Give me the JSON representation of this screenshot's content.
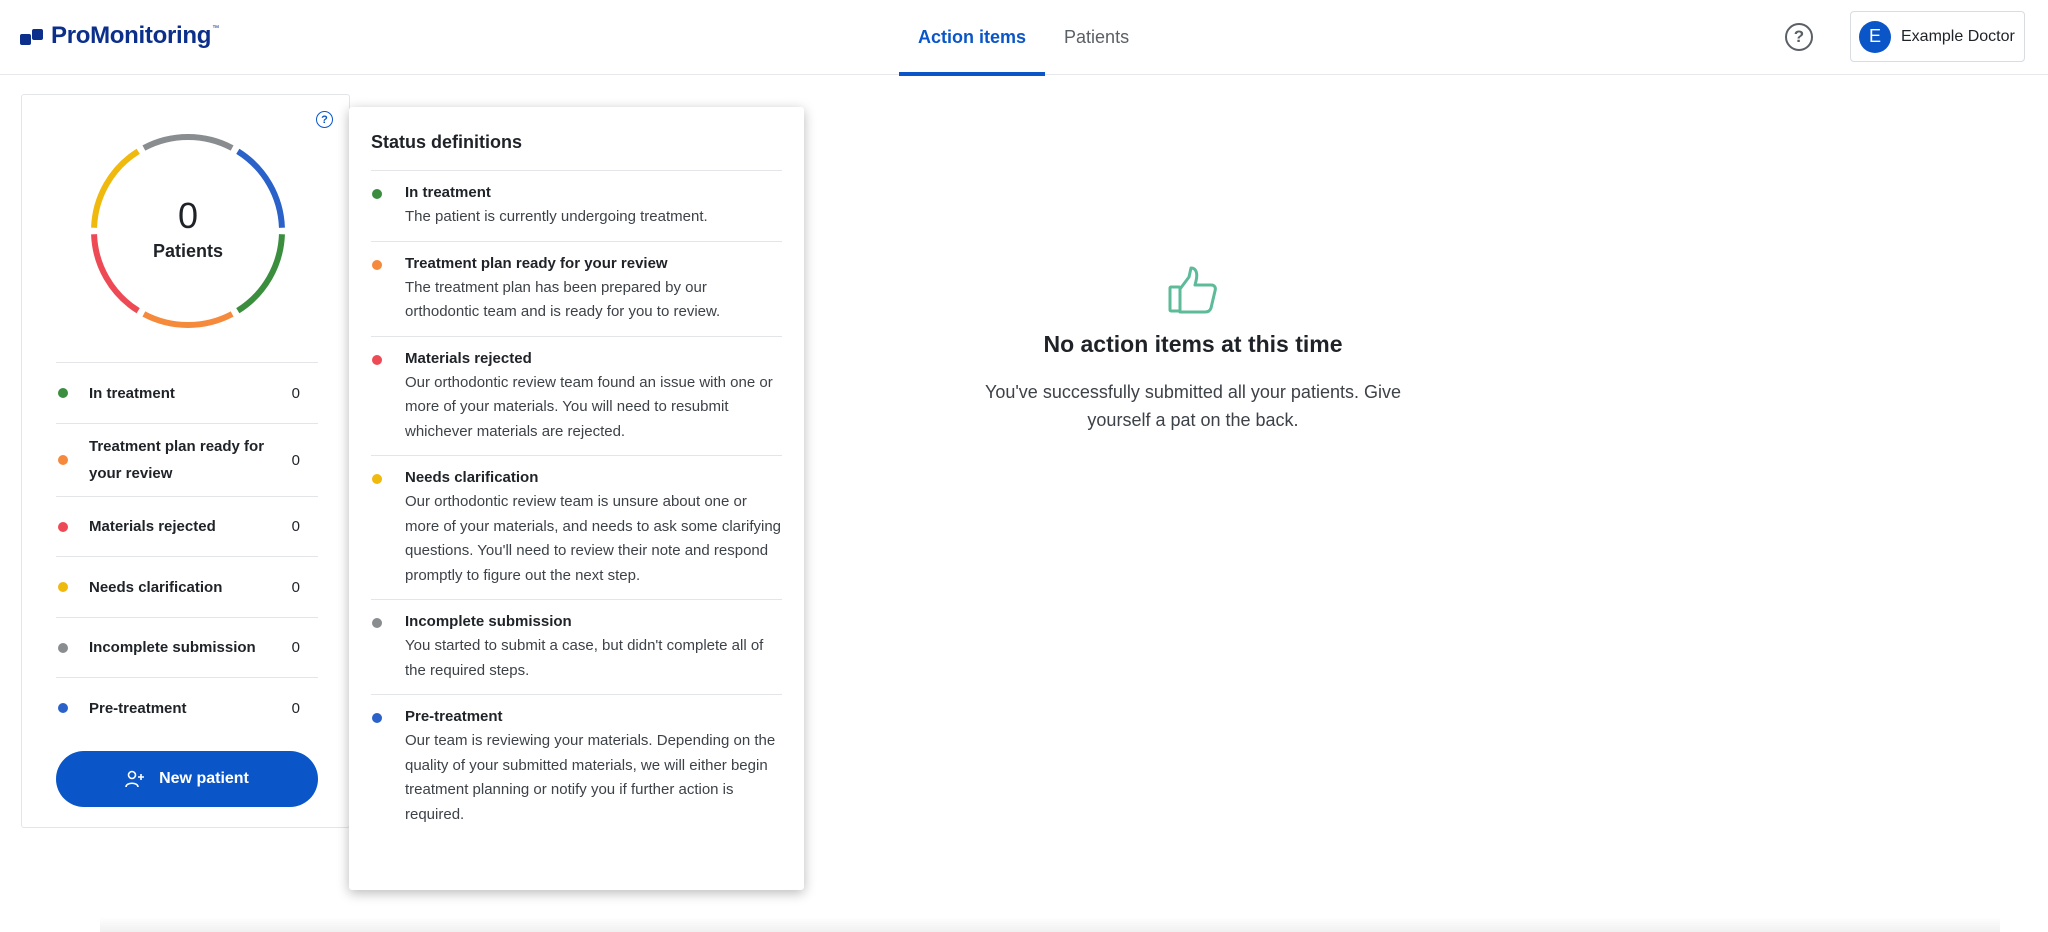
{
  "header": {
    "logo_text": "ProMonitoring",
    "logo_tm": "™",
    "tabs": [
      {
        "label": "Action items",
        "active": true
      },
      {
        "label": "Patients",
        "active": false
      }
    ],
    "help_icon": "question-circle-icon",
    "user": {
      "initial": "E",
      "name": "Example Doctor"
    }
  },
  "colors": {
    "accent": "#0a56c8",
    "in_treatment": "#3a8e3e",
    "plan_ready": "#f58a3d",
    "rejected": "#ee4a55",
    "clarification": "#efb90e",
    "incomplete": "#8a8d90",
    "pre_treatment": "#2a62c9"
  },
  "summary": {
    "total": "0",
    "total_label": "Patients",
    "statuses": [
      {
        "key": "in_treatment",
        "label": "In treatment",
        "count": "0"
      },
      {
        "key": "plan_ready",
        "label": "Treatment plan ready for your review",
        "count": "0"
      },
      {
        "key": "rejected",
        "label": "Materials rejected",
        "count": "0"
      },
      {
        "key": "clarification",
        "label": "Needs clarification",
        "count": "0"
      },
      {
        "key": "incomplete",
        "label": "Incomplete submission",
        "count": "0"
      },
      {
        "key": "pre_treatment",
        "label": "Pre-treatment",
        "count": "0"
      }
    ],
    "new_patient_label": "New patient"
  },
  "popover": {
    "title": "Status definitions",
    "items": [
      {
        "name": "In treatment",
        "desc": "The patient is currently undergoing treatment."
      },
      {
        "name": "Treatment plan ready for your review",
        "desc": "The treatment plan has been prepared by our orthodontic team and is ready for you to review."
      },
      {
        "name": "Materials rejected",
        "desc": "Our orthodontic review team found an issue with one or more of your materials. You will need to resubmit whichever materials are rejected."
      },
      {
        "name": "Needs clarification",
        "desc": "Our orthodontic review team is unsure about one or more of your materials, and needs to ask some clarifying questions. You'll need to review their note and respond promptly to figure out the next step."
      },
      {
        "name": "Incomplete submission",
        "desc": "You started to submit a case, but didn't complete all of the required steps."
      },
      {
        "name": "Pre-treatment",
        "desc": "Our team is reviewing your materials. Depending on the quality of your submitted materials, we will either begin treatment planning or notify you if further action is required."
      }
    ]
  },
  "empty_state": {
    "icon": "thumbs-up-icon",
    "title": "No action items at this time",
    "body": "You've successfully submitted all your patients. Give yourself a pat on the back."
  }
}
